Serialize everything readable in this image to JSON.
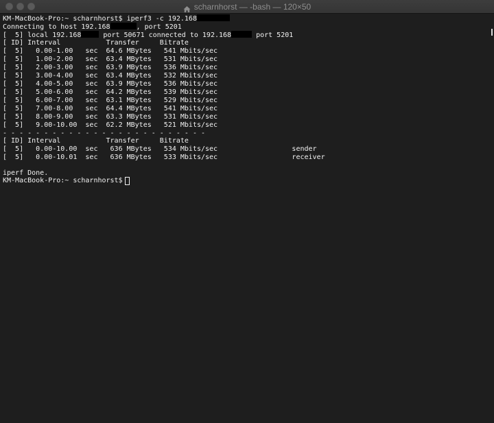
{
  "window": {
    "title": "scharnhorst — -bash — 120×50",
    "title_icon": "home-icon",
    "traffic_lights": [
      "close-button",
      "minimize-button",
      "zoom-button"
    ]
  },
  "colors": {
    "background": "#1e1e1e",
    "text": "#f2f2f2",
    "titlebar": "#3a3a3a",
    "title_text": "#8e8e8e"
  },
  "terminal": {
    "command_line": {
      "prompt": "KM-MacBook-Pro:~ scharnhorst$ ",
      "command": "iperf3 -c 192.168"
    },
    "connecting": {
      "prefix": "Connecting to host 192.168",
      "suffix": ", port 5201"
    },
    "local": {
      "prefix": "[  5] local 192.168",
      "middle": " port 50671 connected to 192.168",
      "suffix": " port 5201"
    },
    "header": "[ ID] Interval           Transfer     Bitrate",
    "intervals": [
      "[  5]   0.00-1.00   sec  64.6 MBytes   541 Mbits/sec",
      "[  5]   1.00-2.00   sec  63.4 MBytes   531 Mbits/sec",
      "[  5]   2.00-3.00   sec  63.9 MBytes   536 Mbits/sec",
      "[  5]   3.00-4.00   sec  63.4 MBytes   532 Mbits/sec",
      "[  5]   4.00-5.00   sec  63.9 MBytes   536 Mbits/sec",
      "[  5]   5.00-6.00   sec  64.2 MBytes   539 Mbits/sec",
      "[  5]   6.00-7.00   sec  63.1 MBytes   529 Mbits/sec",
      "[  5]   7.00-8.00   sec  64.4 MBytes   541 Mbits/sec",
      "[  5]   8.00-9.00   sec  63.3 MBytes   531 Mbits/sec",
      "[  5]   9.00-10.00  sec  62.2 MBytes   521 Mbits/sec"
    ],
    "separator": "- - - - - - - - - - - - - - - - - - - - - - - - -",
    "summary_header": "[ ID] Interval           Transfer     Bitrate",
    "summary": [
      "[  5]   0.00-10.00  sec   636 MBytes   534 Mbits/sec                  sender",
      "[  5]   0.00-10.01  sec   636 MBytes   533 Mbits/sec                  receiver"
    ],
    "done": "iperf Done.",
    "final_prompt": "KM-MacBook-Pro:~ scharnhorst$ "
  }
}
